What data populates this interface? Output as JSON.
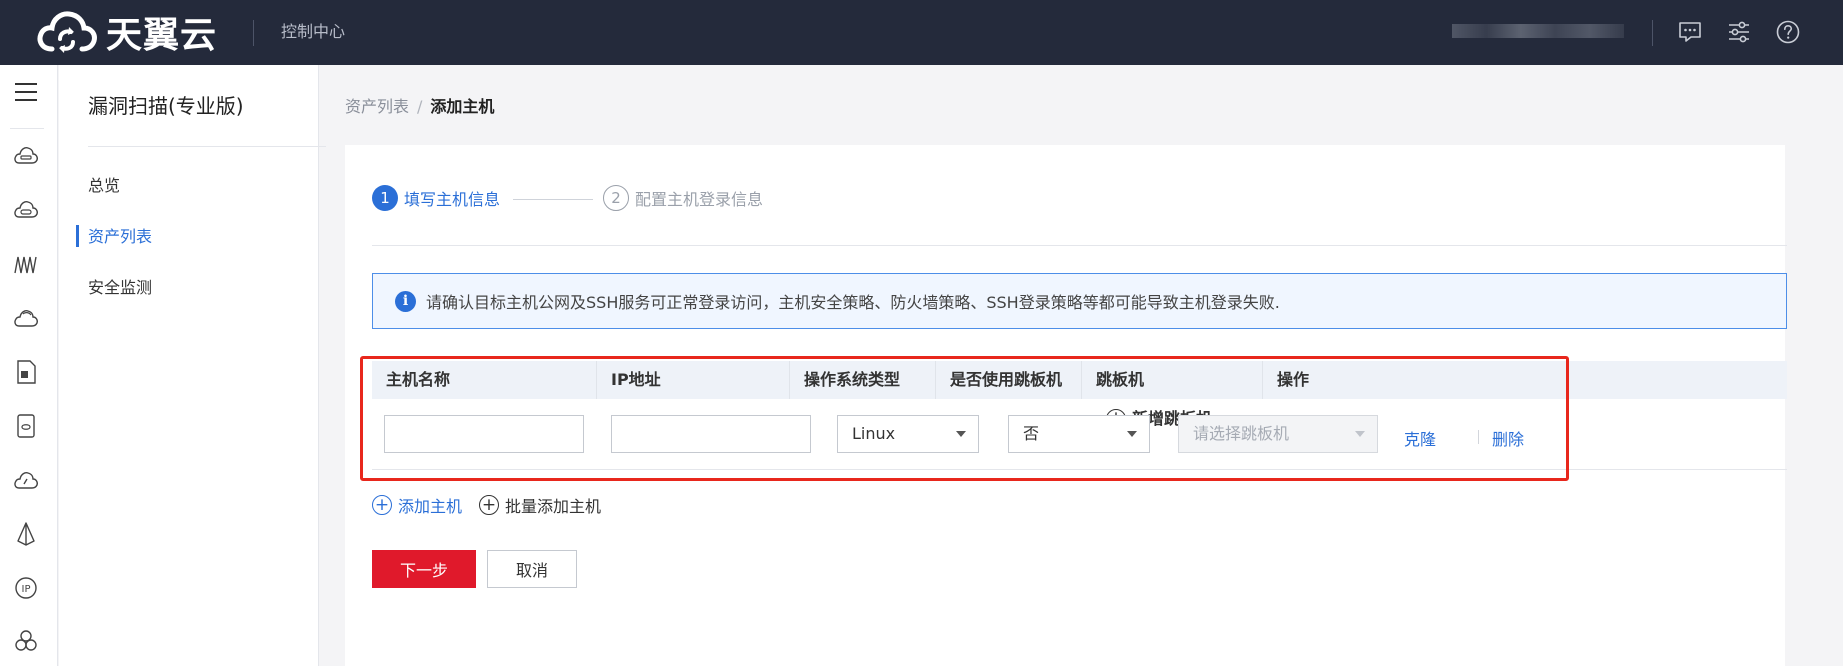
{
  "topbar": {
    "brand": "天翼云",
    "console_link": "控制中心",
    "icons": [
      "message-icon",
      "settings-sliders-icon",
      "help-icon"
    ]
  },
  "iconbar": {
    "icons": [
      "menu-icon",
      "cloud-host-icon",
      "cloud-disk-icon",
      "network-icon",
      "cloud-icon",
      "document-icon",
      "storage-icon",
      "monitor-icon",
      "deploy-icon",
      "ip-icon",
      "cluster-icon"
    ]
  },
  "sidenav": {
    "title": "漏洞扫描(专业版)",
    "items": [
      {
        "label": "总览",
        "active": false
      },
      {
        "label": "资产列表",
        "active": true
      },
      {
        "label": "安全监测",
        "active": false
      }
    ]
  },
  "breadcrumb": {
    "parent": "资产列表",
    "separator": "/",
    "current": "添加主机"
  },
  "steps": [
    {
      "num": "1",
      "label": "填写主机信息",
      "active": true
    },
    {
      "num": "2",
      "label": "配置主机登录信息",
      "active": false
    }
  ],
  "notice": {
    "text": "请确认目标主机公网及SSH服务可正常登录访问，主机安全策略、防火墙策略、SSH登录策略等都可能导致主机登录失败."
  },
  "table": {
    "headers": {
      "host_name": "主机名称",
      "ip": "IP地址",
      "os_type": "操作系统类型",
      "use_jump": "是否使用跳板机",
      "jump": "跳板机",
      "add_jump": "新增跳板机",
      "ops": "操作"
    },
    "row": {
      "host_name_value": "",
      "ip_value": "",
      "os_type_value": "Linux",
      "use_jump_value": "否",
      "jump_placeholder": "请选择跳板机",
      "clone": "克隆",
      "delete": "删除"
    }
  },
  "actions": {
    "add_host": "添加主机",
    "batch_add_host": "批量添加主机",
    "next": "下一步",
    "cancel": "取消"
  },
  "colors": {
    "primary": "#2b6fd7",
    "danger": "#e0192b",
    "highlight_box": "#e8271c",
    "topbar": "#242a3b"
  }
}
